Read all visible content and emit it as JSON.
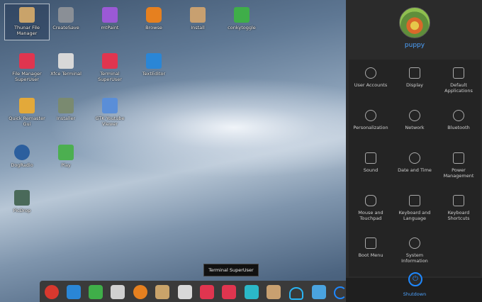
{
  "desktop": {
    "icons": [
      {
        "label": "Thunar File Manager",
        "icon": "folder-icon",
        "color": "#c9a36a"
      },
      {
        "label": "CreateSave",
        "icon": "gear-icon",
        "color": "#8a8f96"
      },
      {
        "label": "mtPaint",
        "icon": "paint-brush-icon",
        "color": "#9b59d6"
      },
      {
        "label": "Browse",
        "icon": "browser-icon",
        "color": "#e6801f"
      },
      {
        "label": "Install",
        "icon": "package-icon",
        "color": "#c8a070"
      },
      {
        "label": "conkytoggle",
        "icon": "pulse-icon",
        "color": "#3fae49"
      },
      {
        "label": "File Manager SuperUser",
        "icon": "lightning-folder-icon",
        "color": "#e0354f"
      },
      {
        "label": "Xfce Terminal",
        "icon": "terminal-icon",
        "color": "#d8d8d8"
      },
      {
        "label": "Terminal SuperUser",
        "icon": "terminal-superuser-icon",
        "color": "#e0354f"
      },
      {
        "label": "TextEditor",
        "icon": "text-editor-icon",
        "color": "#2a86d6"
      },
      {
        "label": "Quick Remaster Gui",
        "icon": "sfs-lock-icon",
        "color": "#e3a93a"
      },
      {
        "label": "Installer",
        "icon": "installer-icon",
        "color": "#7a8a70"
      },
      {
        "label": "GTK Youtube Viewer",
        "icon": "youtube-icon",
        "color": "#5a8ed8"
      },
      {
        "label": "DogRadio",
        "icon": "headphones-icon",
        "color": "#2c5f9e"
      },
      {
        "label": "Play",
        "icon": "play-icon",
        "color": "#4caf50"
      },
      {
        "label": "PicDrop",
        "icon": "picture-icon",
        "color": "#4a6a5a"
      }
    ]
  },
  "panel": {
    "username": "puppy",
    "settings": [
      {
        "label": "User Accounts",
        "icon": "user-icon"
      },
      {
        "label": "Display",
        "icon": "monitor-icon"
      },
      {
        "label": "Default Applications",
        "icon": "default-apps-icon"
      },
      {
        "label": "Personalization",
        "icon": "palette-icon"
      },
      {
        "label": "Network",
        "icon": "network-icon"
      },
      {
        "label": "Bluetooth",
        "icon": "bluetooth-icon"
      },
      {
        "label": "Sound",
        "icon": "speaker-icon"
      },
      {
        "label": "Date and Time",
        "icon": "clock-icon"
      },
      {
        "label": "Power Management",
        "icon": "battery-icon"
      },
      {
        "label": "Mouse and Touchpad",
        "icon": "mouse-icon"
      },
      {
        "label": "Keyboard and Language",
        "icon": "keyboard-icon"
      },
      {
        "label": "Keyboard Shortcuts",
        "icon": "fn-key-icon"
      },
      {
        "label": "Boot Menu",
        "icon": "boot-menu-icon"
      },
      {
        "label": "System Information",
        "icon": "info-icon"
      }
    ],
    "shutdown_label": "Shutdown",
    "accent": "#1e88ff"
  },
  "dock": {
    "tooltip": "Terminal SuperUser",
    "items": [
      {
        "icon": "rocket-icon",
        "color": "#d9382e"
      },
      {
        "icon": "calendar-icon",
        "color": "#2a86d6"
      },
      {
        "icon": "apps-icon",
        "color": "#3fae49"
      },
      {
        "icon": "drive-icon",
        "color": "#d0d0d0"
      },
      {
        "icon": "browser-icon",
        "color": "#e6801f"
      },
      {
        "icon": "folder-icon",
        "color": "#c9a36a"
      },
      {
        "icon": "terminal-icon",
        "color": "#d8d8d8"
      },
      {
        "icon": "lightning-folder-icon",
        "color": "#e0354f"
      },
      {
        "icon": "terminal-superuser-icon",
        "color": "#e0354f"
      },
      {
        "icon": "notes-icon",
        "color": "#2bb8c8"
      },
      {
        "icon": "package-icon",
        "color": "#c8a070"
      },
      {
        "icon": "wifi-icon",
        "color": "#29b6f6"
      },
      {
        "icon": "chart-icon",
        "color": "#4aa3df"
      },
      {
        "icon": "loading-icon",
        "color": "#1e88ff"
      }
    ]
  }
}
